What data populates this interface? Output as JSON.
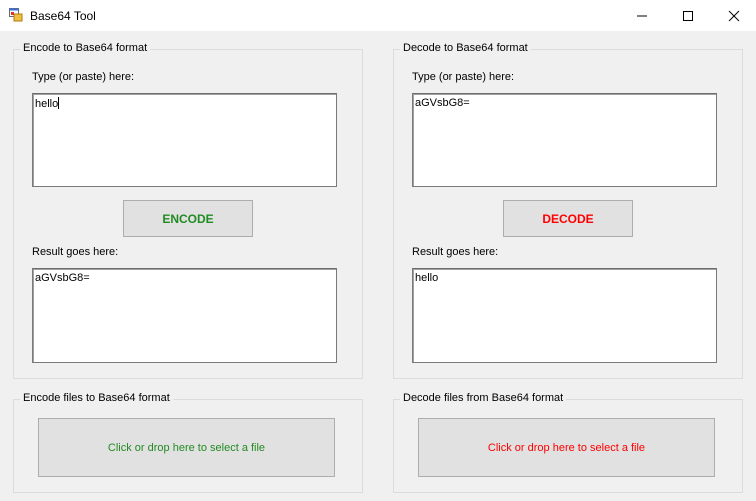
{
  "window": {
    "title": "Base64 Tool",
    "icon": "app-window-icon"
  },
  "encode": {
    "group_title": "Encode to Base64 format",
    "input_label": "Type (or paste) here:",
    "input_value": "hello",
    "button_label": "ENCODE",
    "result_label": "Result goes here:",
    "result_value": "aGVsbG8=",
    "accent_color": "#228b22"
  },
  "decode": {
    "group_title": "Decode to Base64 format",
    "input_label": "Type (or paste) here:",
    "input_value": "aGVsbG8=",
    "button_label": "DECODE",
    "result_label": "Result goes here:",
    "result_value": "hello",
    "accent_color": "#ff0000"
  },
  "encode_files": {
    "group_title": "Encode files to Base64 format",
    "drop_label": "Click or drop here to select a file"
  },
  "decode_files": {
    "group_title": "Decode files from Base64 format",
    "drop_label": "Click or drop here to select a file"
  }
}
